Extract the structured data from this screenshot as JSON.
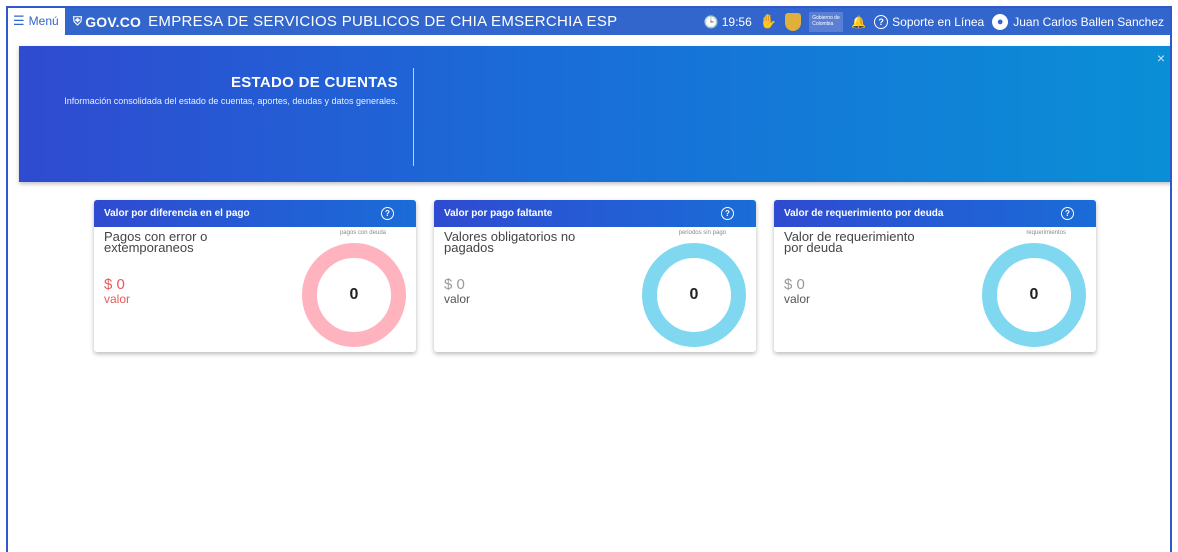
{
  "topbar": {
    "menu_label": "Menú",
    "gov_logo": "GOV.CO",
    "app_title": "EMPRESA DE SERVICIOS PUBLICOS DE CHIA EMSERCHIA ESP",
    "time": "19:56",
    "gob_badge": "Gobierno de Colombia",
    "support_label": "Soporte en Línea",
    "user_name": "Juan Carlos Ballen Sanchez"
  },
  "hero": {
    "title": "ESTADO DE CUENTAS",
    "subtitle": "Información consolidada del estado de cuentas, aportes, deudas y datos generales.",
    "close": "×"
  },
  "cards": [
    {
      "title": "Valor por diferencia en el pago",
      "description": "Pagos con error o extemporaneos",
      "small_label": "pagos con deuda",
      "amount": "$ 0",
      "value_label": "valor",
      "count": "0",
      "ring_color": "#ffb3bf",
      "amount_color": "#e85a5a"
    },
    {
      "title": "Valor por pago faltante",
      "description": "Valores obligatorios no pagados",
      "small_label": "periodos sin pago",
      "amount": "$ 0",
      "value_label": "valor",
      "count": "0",
      "ring_color": "#80d8f0",
      "amount_color": "#9a9a9a"
    },
    {
      "title": "Valor de requerimiento por deuda",
      "description": "Valor de requerimiento por deuda",
      "small_label": "requerimientos",
      "amount": "$ 0",
      "value_label": "valor",
      "count": "0",
      "ring_color": "#80d8f0",
      "amount_color": "#9a9a9a"
    }
  ]
}
